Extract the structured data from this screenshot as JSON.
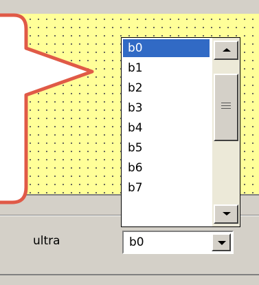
{
  "field": {
    "label": "ultra",
    "selected_value": "b0"
  },
  "dropdown": {
    "items": [
      "b0",
      "b1",
      "b2",
      "b3",
      "b4",
      "b5",
      "b6",
      "b7"
    ],
    "selected_index": 0
  },
  "icons": {
    "combo_toggle": "chevron-down-icon",
    "scroll_up": "scroll-up-arrow-icon",
    "scroll_down": "scroll-down-arrow-icon"
  },
  "colors": {
    "canvas_background": "#ffff99",
    "callout_border": "#e05a47",
    "selection": "#316ac5"
  }
}
